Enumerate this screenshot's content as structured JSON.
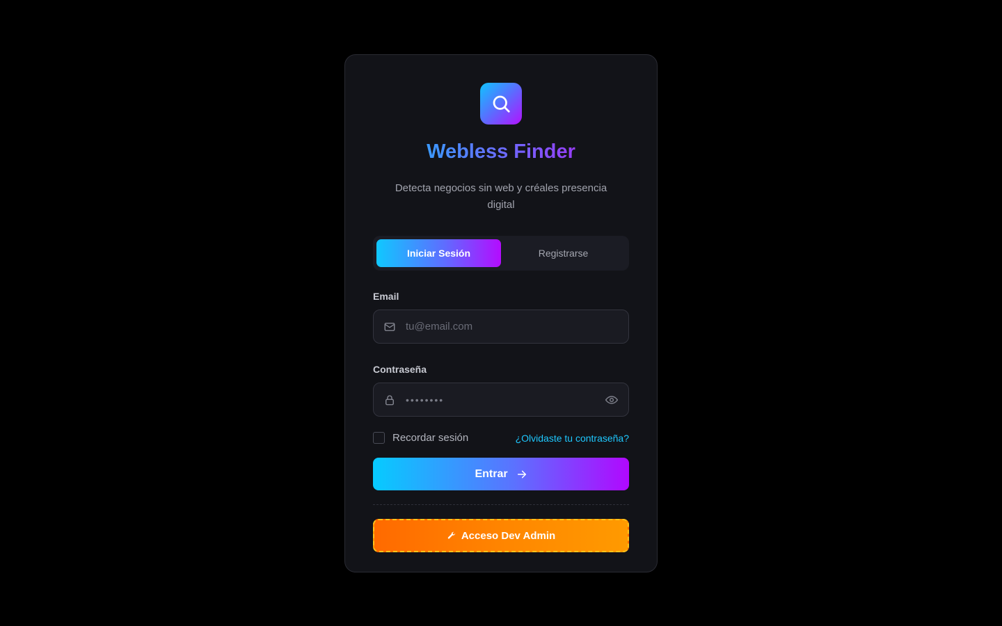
{
  "app": {
    "title": "Webless Finder",
    "subtitle": "Detecta negocios sin web y créales presencia digital",
    "logo_icon": "search-icon"
  },
  "tabs": [
    {
      "label": "Iniciar Sesión",
      "active": true
    },
    {
      "label": "Registrarse",
      "active": false
    }
  ],
  "form": {
    "email": {
      "label": "Email",
      "placeholder": "tu@email.com",
      "value": "",
      "icon": "mail-icon"
    },
    "password": {
      "label": "Contraseña",
      "masked_value": "••••••••",
      "icon": "lock-icon",
      "toggle_icon": "eye-icon"
    },
    "remember_label": "Recordar sesión",
    "remember_checked": false,
    "forgot_label": "¿Olvidaste tu contraseña?",
    "submit_label": "Entrar",
    "submit_icon": "arrow-right-icon"
  },
  "dev_access": {
    "label": "Acceso Dev Admin",
    "icon": "wrench-icon"
  },
  "colors": {
    "accent_cyan": "#0fc4ff",
    "accent_purple": "#b312ff",
    "dev_orange": "#ff7a00",
    "dev_border": "#ffc21a",
    "card_bg": "#121318"
  }
}
